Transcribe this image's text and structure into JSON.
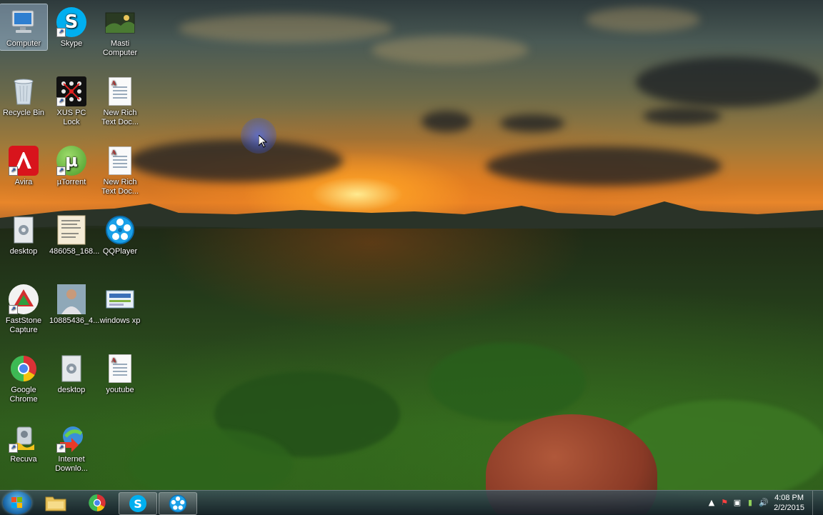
{
  "desktop": {
    "icons": [
      {
        "label": "Computer",
        "glyph": "computer-icon"
      },
      {
        "label": "Skype",
        "glyph": "skype-icon"
      },
      {
        "label": "Masti Computer",
        "glyph": "folder-photo-icon"
      },
      {
        "label": "Recycle Bin",
        "glyph": "recycle-bin-icon"
      },
      {
        "label": "XUS PC Lock",
        "glyph": "xus-lock-icon"
      },
      {
        "label": "New Rich Text Doc...",
        "glyph": "rtf-document-icon"
      },
      {
        "label": "Avira",
        "glyph": "avira-icon"
      },
      {
        "label": "µTorrent",
        "glyph": "utorrent-icon"
      },
      {
        "label": "New Rich Text Doc...",
        "glyph": "rtf-document-icon"
      },
      {
        "label": "desktop",
        "glyph": "settings-file-icon"
      },
      {
        "label": "486058_168...",
        "glyph": "image-thumbnail-icon"
      },
      {
        "label": "QQPlayer",
        "glyph": "qqplayer-icon"
      },
      {
        "label": "FastStone Capture",
        "glyph": "faststone-icon"
      },
      {
        "label": "10885436_4...",
        "glyph": "photo-thumbnail-icon"
      },
      {
        "label": "windows xp",
        "glyph": "image-file-icon"
      },
      {
        "label": "Google Chrome",
        "glyph": "chrome-icon"
      },
      {
        "label": "desktop",
        "glyph": "settings-file-icon"
      },
      {
        "label": "youtube",
        "glyph": "rtf-document-icon"
      },
      {
        "label": "Recuva",
        "glyph": "recuva-icon"
      },
      {
        "label": "Internet Downlo...",
        "glyph": "idm-icon"
      }
    ]
  },
  "taskbar": {
    "start": "windows-start-icon",
    "pinned": [
      "file-explorer-icon",
      "chrome-icon",
      "skype-icon",
      "qqplayer-icon"
    ],
    "tray": {
      "time": "4:08 PM",
      "date": "2/2/2015"
    }
  },
  "colors": {
    "accent": "#1f6fb0",
    "taskbar": "#1e2c36"
  }
}
